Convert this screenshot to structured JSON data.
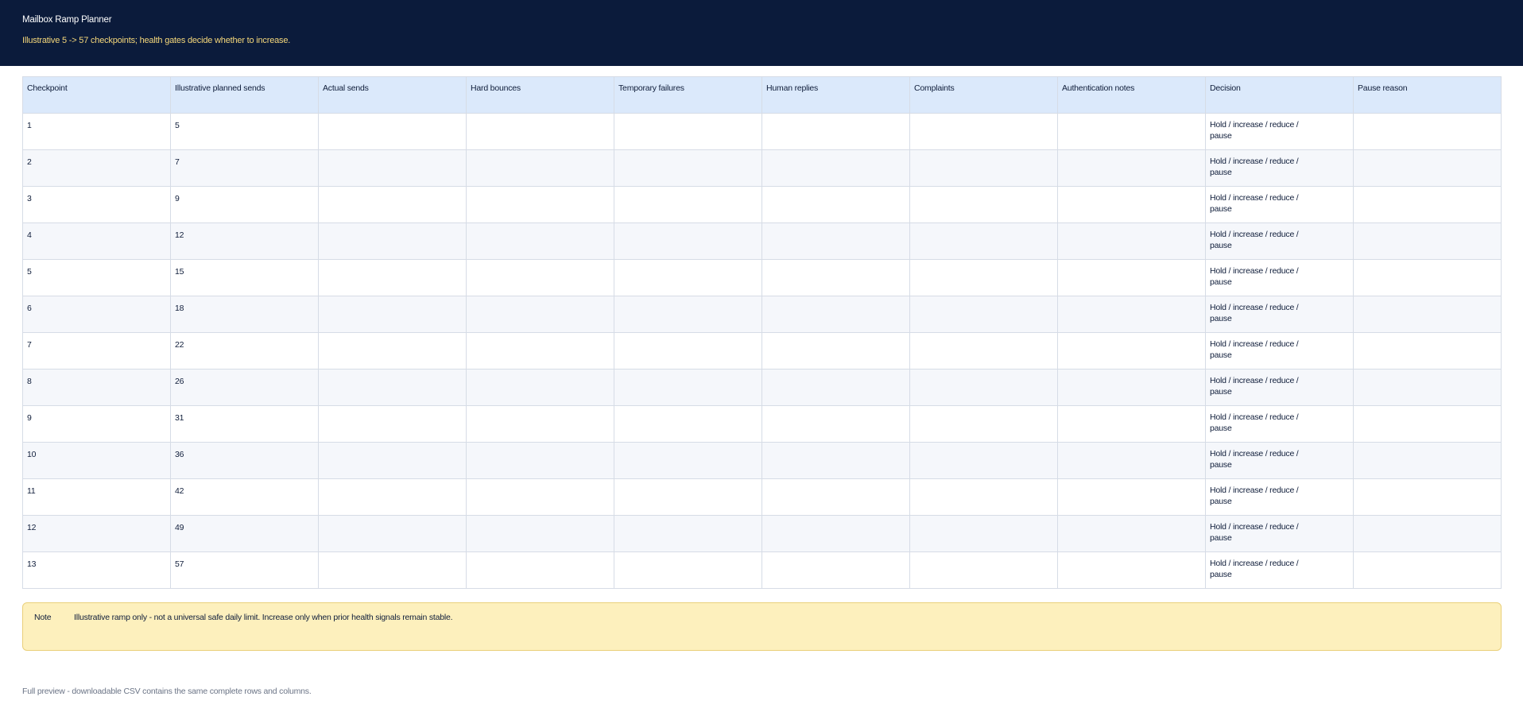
{
  "header": {
    "title": "Mailbox Ramp Planner",
    "subtitle": "Illustrative 5 -> 57 checkpoints; health gates decide whether to increase."
  },
  "table": {
    "columns": [
      "Checkpoint",
      "Illustrative planned sends",
      "Actual sends",
      "Hard bounces",
      "Temporary failures",
      "Human replies",
      "Complaints",
      "Authentication notes",
      "Decision",
      "Pause reason"
    ],
    "rows": [
      {
        "checkpoint": "1",
        "planned": "5",
        "decision": "Hold / increase / reduce / pause"
      },
      {
        "checkpoint": "2",
        "planned": "7",
        "decision": "Hold / increase / reduce / pause"
      },
      {
        "checkpoint": "3",
        "planned": "9",
        "decision": "Hold / increase / reduce / pause"
      },
      {
        "checkpoint": "4",
        "planned": "12",
        "decision": "Hold / increase / reduce / pause"
      },
      {
        "checkpoint": "5",
        "planned": "15",
        "decision": "Hold / increase / reduce / pause"
      },
      {
        "checkpoint": "6",
        "planned": "18",
        "decision": "Hold / increase / reduce / pause"
      },
      {
        "checkpoint": "7",
        "planned": "22",
        "decision": "Hold / increase / reduce / pause"
      },
      {
        "checkpoint": "8",
        "planned": "26",
        "decision": "Hold / increase / reduce / pause"
      },
      {
        "checkpoint": "9",
        "planned": "31",
        "decision": "Hold / increase / reduce / pause"
      },
      {
        "checkpoint": "10",
        "planned": "36",
        "decision": "Hold / increase / reduce / pause"
      },
      {
        "checkpoint": "11",
        "planned": "42",
        "decision": "Hold / increase / reduce / pause"
      },
      {
        "checkpoint": "12",
        "planned": "49",
        "decision": "Hold / increase / reduce / pause"
      },
      {
        "checkpoint": "13",
        "planned": "57",
        "decision": "Hold / increase / reduce / pause"
      }
    ]
  },
  "note": {
    "label": "Note",
    "text": "Illustrative ramp only - not a universal safe daily limit. Increase only when prior health signals remain stable."
  },
  "footer": {
    "text": "Full preview - downloadable CSV contains the same complete rows and columns."
  },
  "colors": {
    "header_bg": "#0b1b3b",
    "subtitle": "#f5d77a",
    "table_header_bg": "#dbe9fb",
    "note_bg": "#fdf0bd"
  }
}
